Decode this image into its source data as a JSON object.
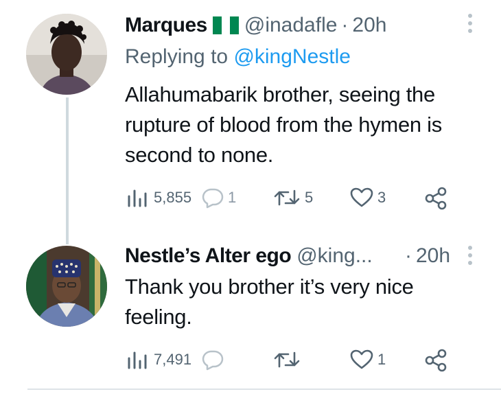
{
  "tweets": [
    {
      "display_name": "Marques",
      "flag_emoji": "nigeria-flag",
      "handle": "@inadafle",
      "separator": "·",
      "time": "20h",
      "replying_prefix": "Replying to",
      "replying_handle": "@kingNestle",
      "text": "Allahumabarik brother, seeing the\nrupture of blood from the hymen is\nsecond to none.",
      "views": "5,855",
      "replies": "1",
      "retweets": "5",
      "likes": "3"
    },
    {
      "display_name": "Nestle’s Alter ego",
      "handle": "@king...",
      "separator": "·",
      "time": "20h",
      "text": "Thank you brother it’s very nice\nfeeling.",
      "views": "7,491",
      "replies": "",
      "retweets": "",
      "likes": "1"
    }
  ],
  "colors": {
    "text": "#0f1419",
    "muted": "#536471",
    "link": "#1d9bf0",
    "thread_line": "#cfd9de",
    "flag_green": "#008751"
  }
}
